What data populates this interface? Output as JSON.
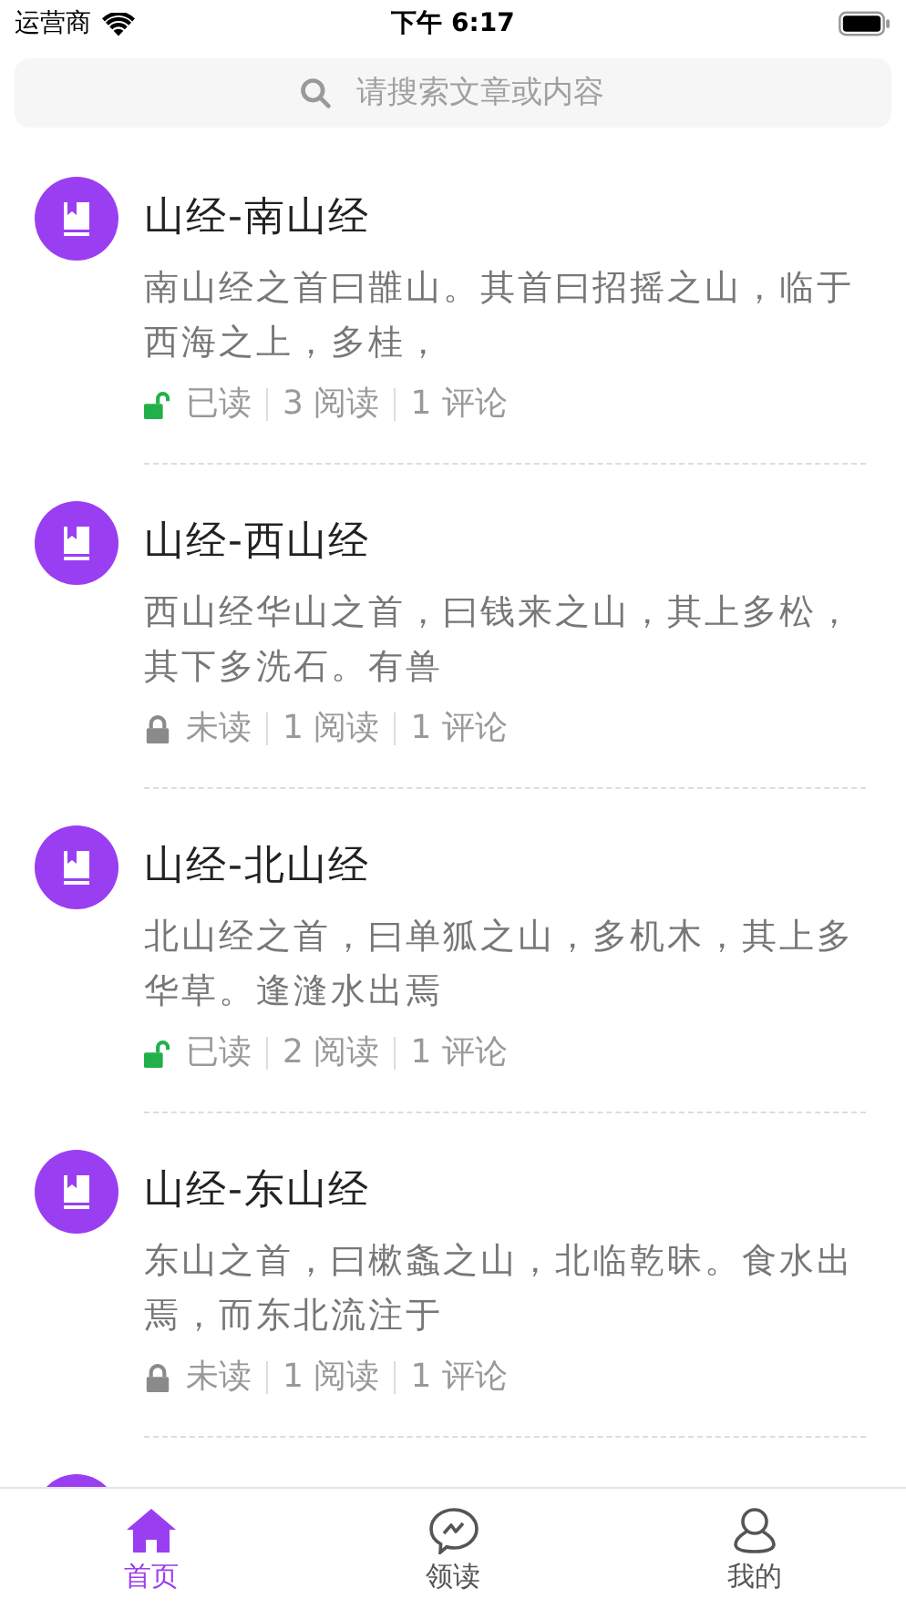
{
  "status_bar": {
    "carrier": "运营商",
    "time": "下午 6:17"
  },
  "search": {
    "placeholder": "请搜索文章或内容"
  },
  "articles": [
    {
      "kind": "article",
      "title": "山经-南山经",
      "summary": "南山经之首曰䧿山。其首曰招摇之山，临于西海之上，多桂，",
      "read": true,
      "read_label": "已读",
      "views": "3 阅读",
      "comments": "1 评论"
    },
    {
      "kind": "article",
      "title": "山经-西山经",
      "summary": "西山经华山之首，曰钱来之山，其上多松，其下多洗石。有兽",
      "read": false,
      "read_label": "未读",
      "views": "1 阅读",
      "comments": "1 评论"
    },
    {
      "kind": "article",
      "title": "山经-北山经",
      "summary": "北山经之首，曰单狐之山，多机木，其上多华草。逢漨水出焉",
      "read": true,
      "read_label": "已读",
      "views": "2 阅读",
      "comments": "1 评论"
    },
    {
      "kind": "article",
      "title": "山经-东山经",
      "summary": "东山之首，曰樕螽之山，北临乾昧。食水出焉，而东北流注于",
      "read": false,
      "read_label": "未读",
      "views": "1 阅读",
      "comments": "1 评论"
    },
    {
      "kind": "avatar_only"
    }
  ],
  "tabs": [
    {
      "label": "首页",
      "kind": "home",
      "selected": true
    },
    {
      "label": "领读",
      "kind": "chat",
      "selected": false
    },
    {
      "label": "我的",
      "kind": "user",
      "selected": false
    }
  ]
}
